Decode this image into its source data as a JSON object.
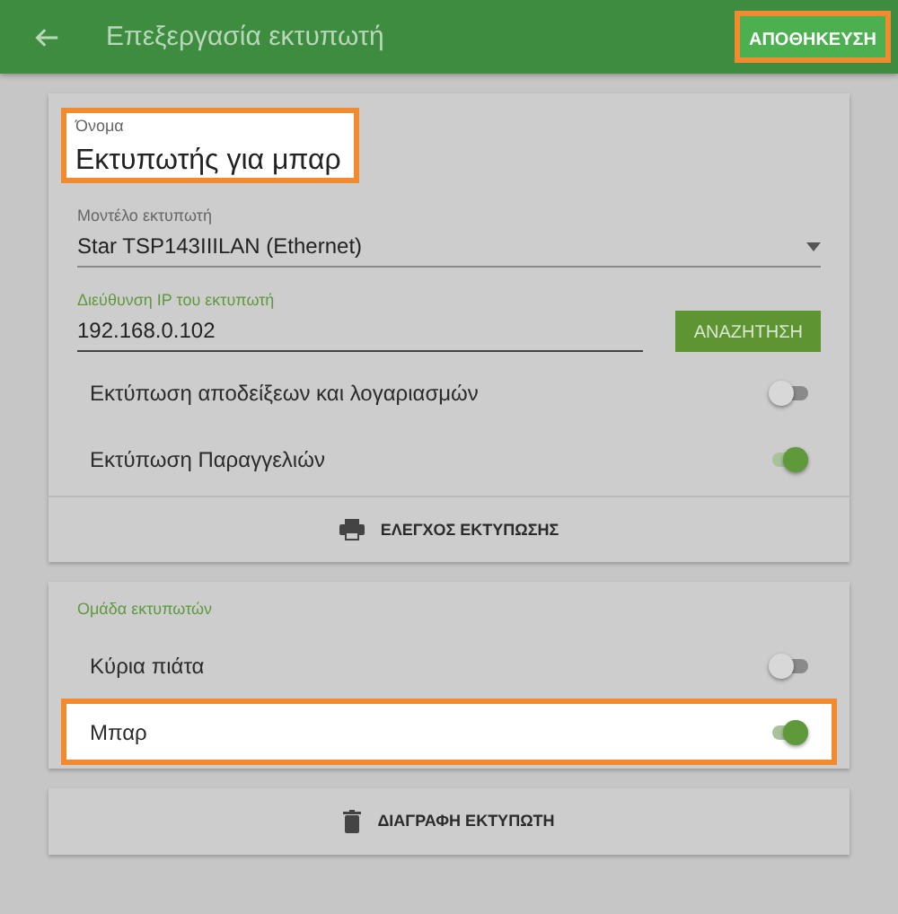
{
  "app_bar": {
    "title": "Επεξεργασία εκτυπωτή",
    "save_button": {
      "label": "ΑΠΟΘΗΚΕΥΣΗ",
      "highlighted": true
    }
  },
  "printer_card": {
    "name_field": {
      "label": "Όνομα",
      "value": "Εκτυπωτής για μπαρ",
      "highlighted": true
    },
    "model_field": {
      "label": "Μοντέλο εκτυπωτή",
      "value": "Star TSP143IIILAN (Ethernet)"
    },
    "ip_field": {
      "label": "Διεύθυνση IP του εκτυπωτή",
      "value": "192.168.0.102",
      "focused": true
    },
    "search_button": "ΑΝΑΖΗΤΗΣΗ",
    "toggles": [
      {
        "label": "Εκτύπωση αποδείξεων και λογαριασμών",
        "on": false,
        "highlighted": false
      },
      {
        "label": "Εκτύπωση Παραγγελιών",
        "on": true,
        "highlighted": false
      }
    ],
    "test_button": "ΕΛΕΓΧΟΣ ΕΚΤΥΠΩΣΗΣ"
  },
  "group_card": {
    "title": "Ομάδα εκτυπωτών",
    "toggles": [
      {
        "label": "Κύρια πιάτα",
        "on": false,
        "highlighted": false
      },
      {
        "label": "Μπαρ",
        "on": true,
        "highlighted": true
      }
    ]
  },
  "delete_button": "ΔΙΑΓΡΑΦΗ ΕΚΤΥΠΩΤΗ"
}
